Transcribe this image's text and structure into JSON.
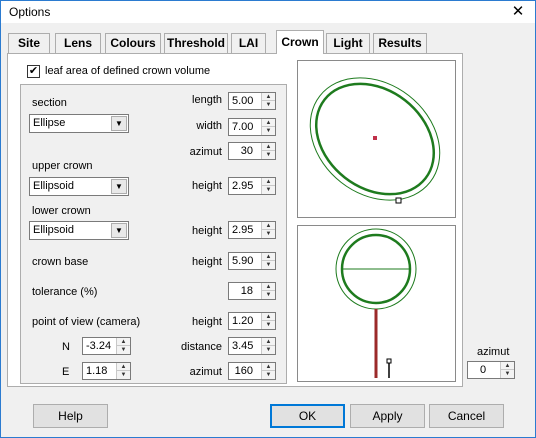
{
  "window": {
    "title": "Options",
    "close_glyph": "✕"
  },
  "tabs": [
    {
      "label": "Site"
    },
    {
      "label": "Lens"
    },
    {
      "label": "Colours"
    },
    {
      "label": "Threshold"
    },
    {
      "label": "LAI"
    },
    {
      "label": "Crown"
    },
    {
      "label": "Light"
    },
    {
      "label": "Results"
    }
  ],
  "active_tab": "Crown",
  "crown": {
    "leaf_area_checked": true,
    "leaf_area_label": "leaf area of defined crown volume",
    "section": {
      "label": "section",
      "shape": "Ellipse",
      "length_label": "length",
      "length": "5.00",
      "width_label": "width",
      "width": "7.00",
      "azimut_label": "azimut",
      "azimut": "30"
    },
    "upper_crown": {
      "label": "upper crown",
      "shape": "Ellipsoid",
      "height_label": "height",
      "height": "2.95"
    },
    "lower_crown": {
      "label": "lower crown",
      "shape": "Ellipsoid",
      "height_label": "height",
      "height": "2.95"
    },
    "crown_base": {
      "label": "crown base",
      "height_label": "height",
      "height": "5.90"
    },
    "tolerance": {
      "label": "tolerance (%)",
      "value": "18"
    },
    "point_of_view": {
      "label": "point of view (camera)",
      "height_label": "height",
      "height": "1.20",
      "n_label": "N",
      "n": "-3.24",
      "e_label": "E",
      "e": "1.18",
      "distance_label": "distance",
      "distance": "3.45",
      "azimut_label": "azimut",
      "azimut": "160"
    },
    "view_azimut_label": "azimut",
    "view_azimut": "0"
  },
  "buttons": {
    "help": "Help",
    "ok": "OK",
    "apply": "Apply",
    "cancel": "Cancel"
  },
  "colors": {
    "crown": "#1e7b1e",
    "trunk": "#9b2a2a",
    "center": "#c0304a"
  },
  "icons": {
    "checkmark": "✔",
    "spin_up": "▲",
    "spin_down": "▼",
    "dropdown": "▼"
  }
}
